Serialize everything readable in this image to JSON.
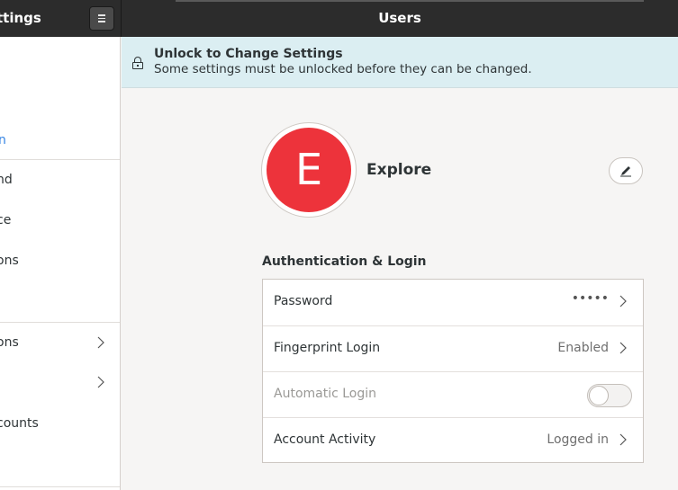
{
  "window": {
    "app_title": "ttings",
    "page_title": "Users"
  },
  "sidebar": {
    "items": [
      {
        "label": "nd"
      },
      {
        "label": "ce"
      },
      {
        "label": "ons"
      },
      {
        "label": "ons"
      },
      {
        "label": ""
      },
      {
        "label": "counts"
      }
    ],
    "active_marker": "n"
  },
  "infobar": {
    "title": "Unlock to Change Settings",
    "subtitle": "Some settings must be unlocked before they can be changed.",
    "icon": "lock-icon"
  },
  "user": {
    "initial": "E",
    "name": "Explore",
    "avatar_color": "#ed333b"
  },
  "auth": {
    "section_title": "Authentication & Login",
    "rows": [
      {
        "label": "Password",
        "value": "•••••"
      },
      {
        "label": "Fingerprint Login",
        "value": "Enabled"
      },
      {
        "label": "Automatic Login",
        "toggle_on": false
      },
      {
        "label": "Account Activity",
        "value": "Logged in"
      }
    ]
  },
  "colors": {
    "headerbar": "#2c2c2c",
    "infobar": "#dbeef2",
    "accent": "#3584e4"
  }
}
